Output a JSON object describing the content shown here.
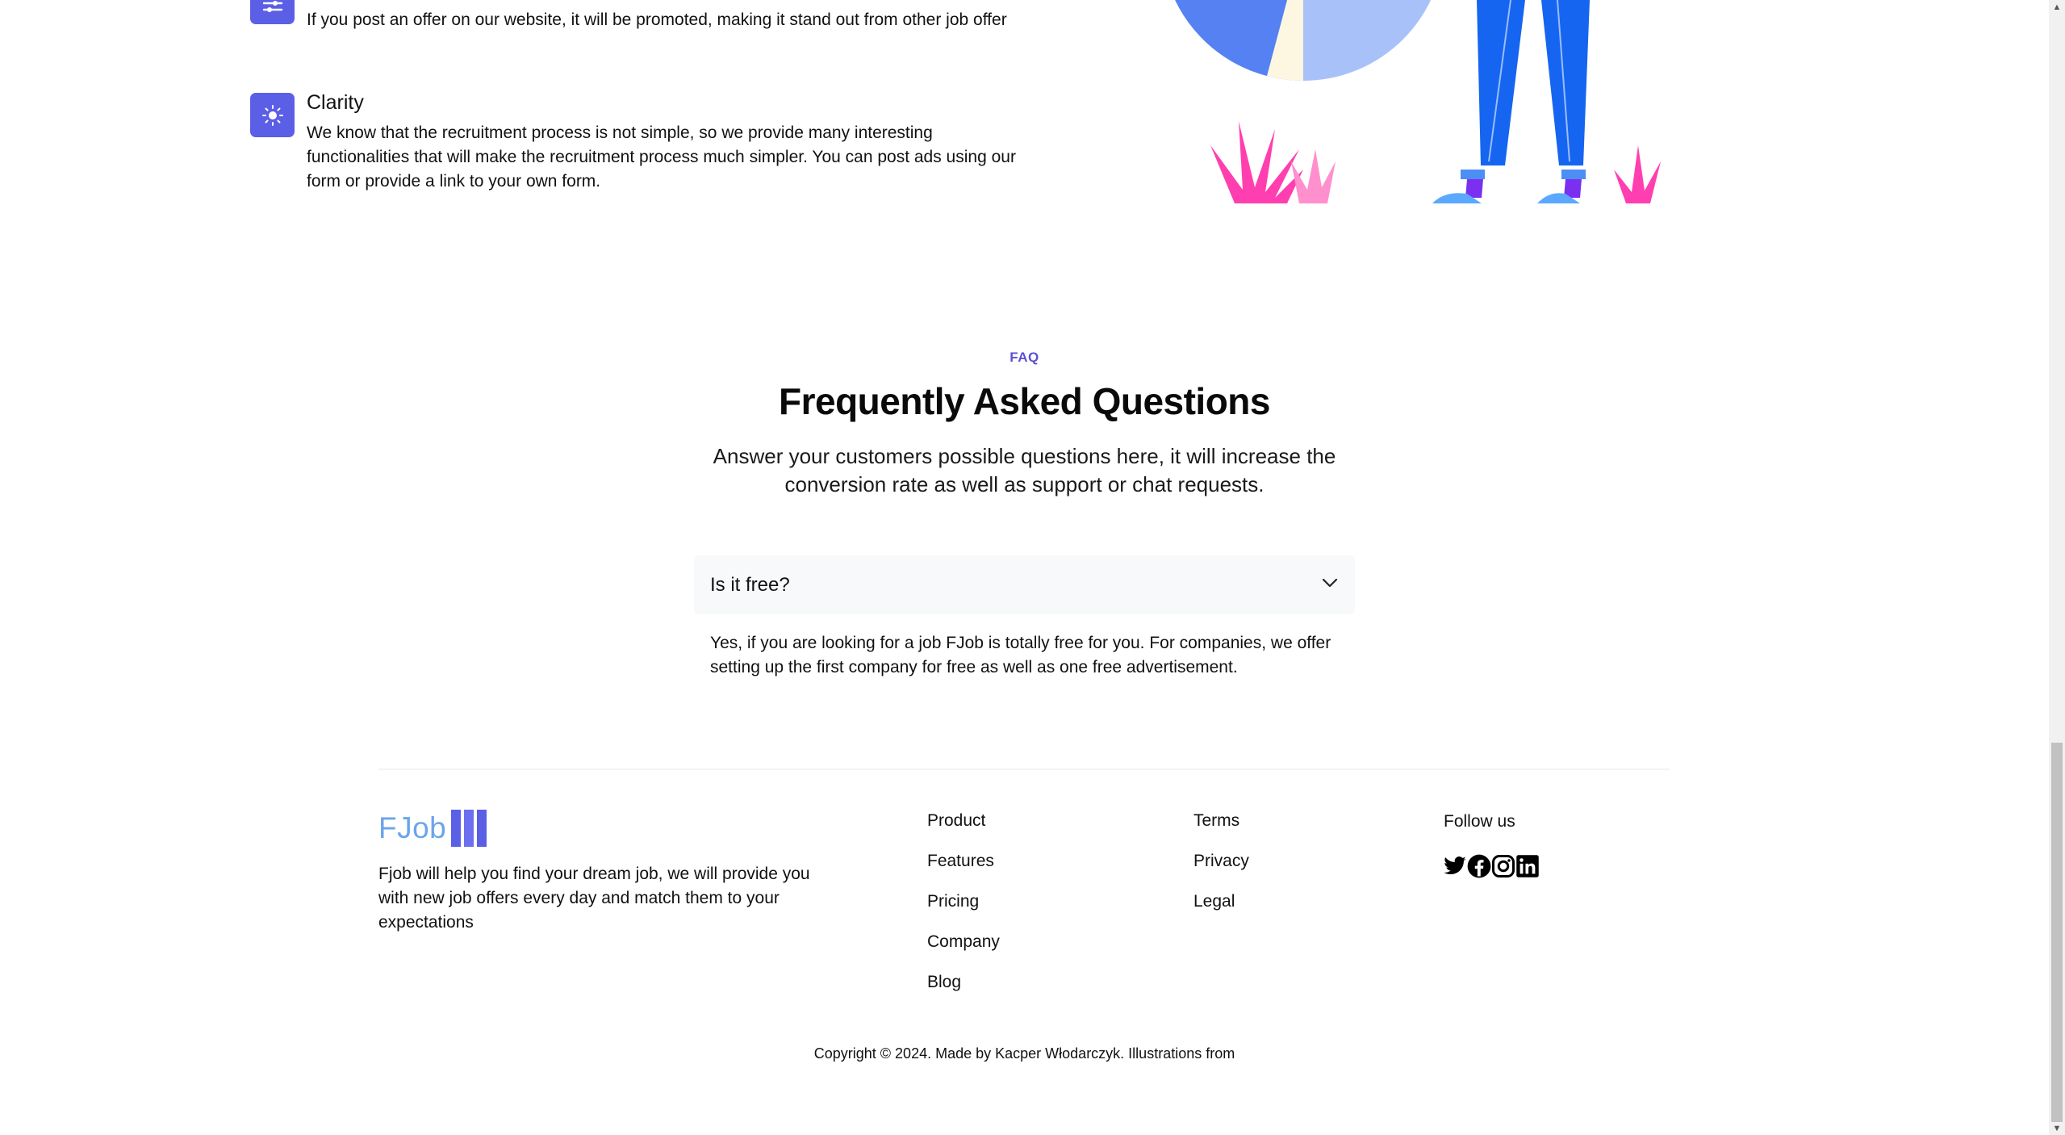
{
  "features": [
    {
      "icon": "sliders-icon",
      "title": "",
      "text": "If you post an offer on our website, it will be promoted, making it stand out from other job offer"
    },
    {
      "icon": "sun-icon",
      "title": "Clarity",
      "text": "We know that the recruitment process is not simple, so we provide many interesting functionalities that will make the recruitment process much simpler. You can post ads using our form or provide a link to your own form."
    }
  ],
  "faq": {
    "eyebrow": "FAQ",
    "title": "Frequently Asked Questions",
    "subtitle_line1": "Answer your customers possible questions here, it will increase the",
    "subtitle_line2": "conversion rate as well as support or chat requests.",
    "items": [
      {
        "question": "Is it free?",
        "answer": "Yes, if you are looking for a job FJob is totally free for you. For companies, we offer setting up the first company for free as well as one free advertisement.",
        "expanded": true
      }
    ]
  },
  "footer": {
    "logo_text": "FJob",
    "description": "Fjob will help you find your dream job, we will provide you with new job offers every day and match them to your expectations",
    "product_links": [
      "Product",
      "Features",
      "Pricing",
      "Company",
      "Blog"
    ],
    "legal_links": [
      "Terms",
      "Privacy",
      "Legal"
    ],
    "follow_label": "Follow us",
    "social_icons": [
      "twitter-icon",
      "facebook-icon",
      "instagram-icon",
      "linkedin-icon"
    ],
    "copyright": "Copyright © 2024. Made by Kacper Włodarczyk. Illustrations from"
  },
  "colors": {
    "accent": "#5b5fe6",
    "eyebrow": "#5b50d6",
    "logo_light": "#6aa5ea",
    "plant_pink": "#ff4fb8",
    "figure_blue": "#1565f0"
  }
}
